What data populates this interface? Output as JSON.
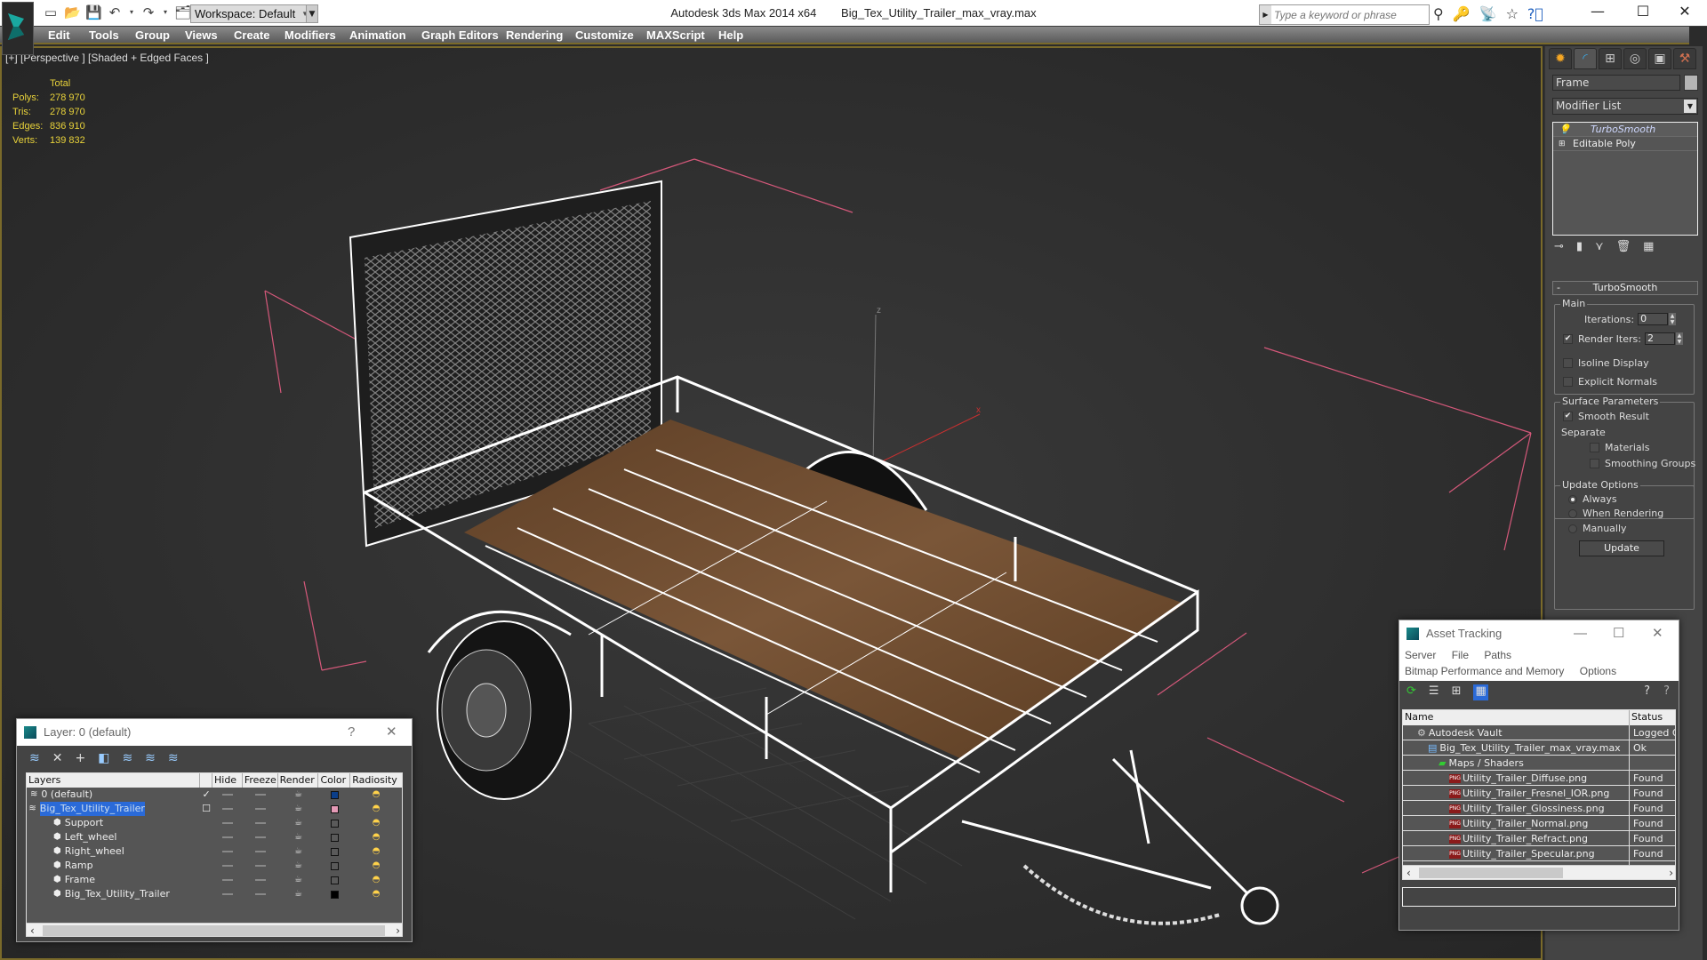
{
  "app": {
    "title": "Autodesk 3ds Max  2014 x64",
    "file": "Big_Tex_Utility_Trailer_max_vray.max",
    "workspace": "Workspace: Default",
    "search_placeholder": "Type a keyword or phrase"
  },
  "menu": [
    "Edit",
    "Tools",
    "Group",
    "Views",
    "Create",
    "Modifiers",
    "Animation",
    "Graph Editors",
    "Rendering",
    "Customize",
    "MAXScript",
    "Help"
  ],
  "viewport": {
    "label": "[+] [Perspective ] [Shaded + Edged Faces ]",
    "stats": {
      "header": "Total",
      "rows": [
        {
          "k": "Polys:",
          "v": "278 970"
        },
        {
          "k": "Tris:",
          "v": "278 970"
        },
        {
          "k": "Edges:",
          "v": "836 910"
        },
        {
          "k": "Verts:",
          "v": "139 832"
        }
      ]
    },
    "axis_labels": {
      "x": "x",
      "z": "z"
    }
  },
  "command_panel": {
    "object_name": "Frame",
    "modifier_list": "Modifier List",
    "stack": [
      "TurboSmooth",
      "Editable Poly"
    ],
    "rollout": "TurboSmooth",
    "main_group": "Main",
    "iterations_label": "Iterations:",
    "iterations": "0",
    "render_iters_label": "Render Iters:",
    "render_iters": "2",
    "render_iters_checked": true,
    "isoline_label": "Isoline Display",
    "isoline_checked": false,
    "explicit_label": "Explicit Normals",
    "explicit_checked": false,
    "surface_group": "Surface Parameters",
    "smooth_result_label": "Smooth Result",
    "smooth_result_checked": true,
    "separate_label": "Separate",
    "materials_label": "Materials",
    "smoothing_groups_label": "Smoothing Groups",
    "update_group": "Update Options",
    "update_options": [
      "Always",
      "When Rendering",
      "Manually"
    ],
    "update_selected": "Always",
    "update_button": "Update"
  },
  "layer_dialog": {
    "title": "Layer: 0 (default)",
    "help": "?",
    "columns": [
      "Layers",
      "",
      "Hide",
      "Freeze",
      "Render",
      "Color",
      "Radiosity"
    ],
    "rows": [
      {
        "name": "0 (default)",
        "type": "layer",
        "indent": 0,
        "current": true,
        "color": "#0b3e8a"
      },
      {
        "name": "Big_Tex_Utility_Trailer",
        "type": "layer",
        "indent": 0,
        "selected": true,
        "expanded": true,
        "color": "#e49ab6"
      },
      {
        "name": "Support",
        "type": "object",
        "indent": 1,
        "color": "#5a5a5a"
      },
      {
        "name": "Left_wheel",
        "type": "object",
        "indent": 1,
        "color": "#5a5a5a"
      },
      {
        "name": "Right_wheel",
        "type": "object",
        "indent": 1,
        "color": "#5a5a5a"
      },
      {
        "name": "Ramp",
        "type": "object",
        "indent": 1,
        "color": "#5a5a5a"
      },
      {
        "name": "Frame",
        "type": "object",
        "indent": 1,
        "color": "#5a5a5a"
      },
      {
        "name": "Big_Tex_Utility_Trailer",
        "type": "object",
        "indent": 1,
        "color": "#000000"
      }
    ]
  },
  "asset_dialog": {
    "title": "Asset Tracking",
    "menu1": [
      "Server",
      "File",
      "Paths"
    ],
    "menu2": [
      "Bitmap Performance and Memory",
      "Options"
    ],
    "columns": [
      "Name",
      "Status"
    ],
    "rows": [
      {
        "name": "Autodesk Vault",
        "status": "Logged O",
        "indent": 1,
        "icon": "vault"
      },
      {
        "name": "Big_Tex_Utility_Trailer_max_vray.max",
        "status": "Ok",
        "indent": 2,
        "icon": "max"
      },
      {
        "name": "Maps / Shaders",
        "status": "",
        "indent": 3,
        "icon": "maps"
      },
      {
        "name": "Utility_Trailer_Diffuse.png",
        "status": "Found",
        "indent": 4,
        "icon": "png"
      },
      {
        "name": "Utility_Trailer_Fresnel_IOR.png",
        "status": "Found",
        "indent": 4,
        "icon": "png"
      },
      {
        "name": "Utility_Trailer_Glossiness.png",
        "status": "Found",
        "indent": 4,
        "icon": "png"
      },
      {
        "name": "Utility_Trailer_Normal.png",
        "status": "Found",
        "indent": 4,
        "icon": "png"
      },
      {
        "name": "Utility_Trailer_Refract.png",
        "status": "Found",
        "indent": 4,
        "icon": "png"
      },
      {
        "name": "Utility_Trailer_Specular.png",
        "status": "Found",
        "indent": 4,
        "icon": "png"
      }
    ],
    "png_badge": "PNG"
  },
  "colors": {
    "stats_text": "#e8d23a",
    "viewport_border": "#7a6a2a",
    "selection_blue": "#2a6ad8",
    "wood": "#6b4a2e"
  }
}
